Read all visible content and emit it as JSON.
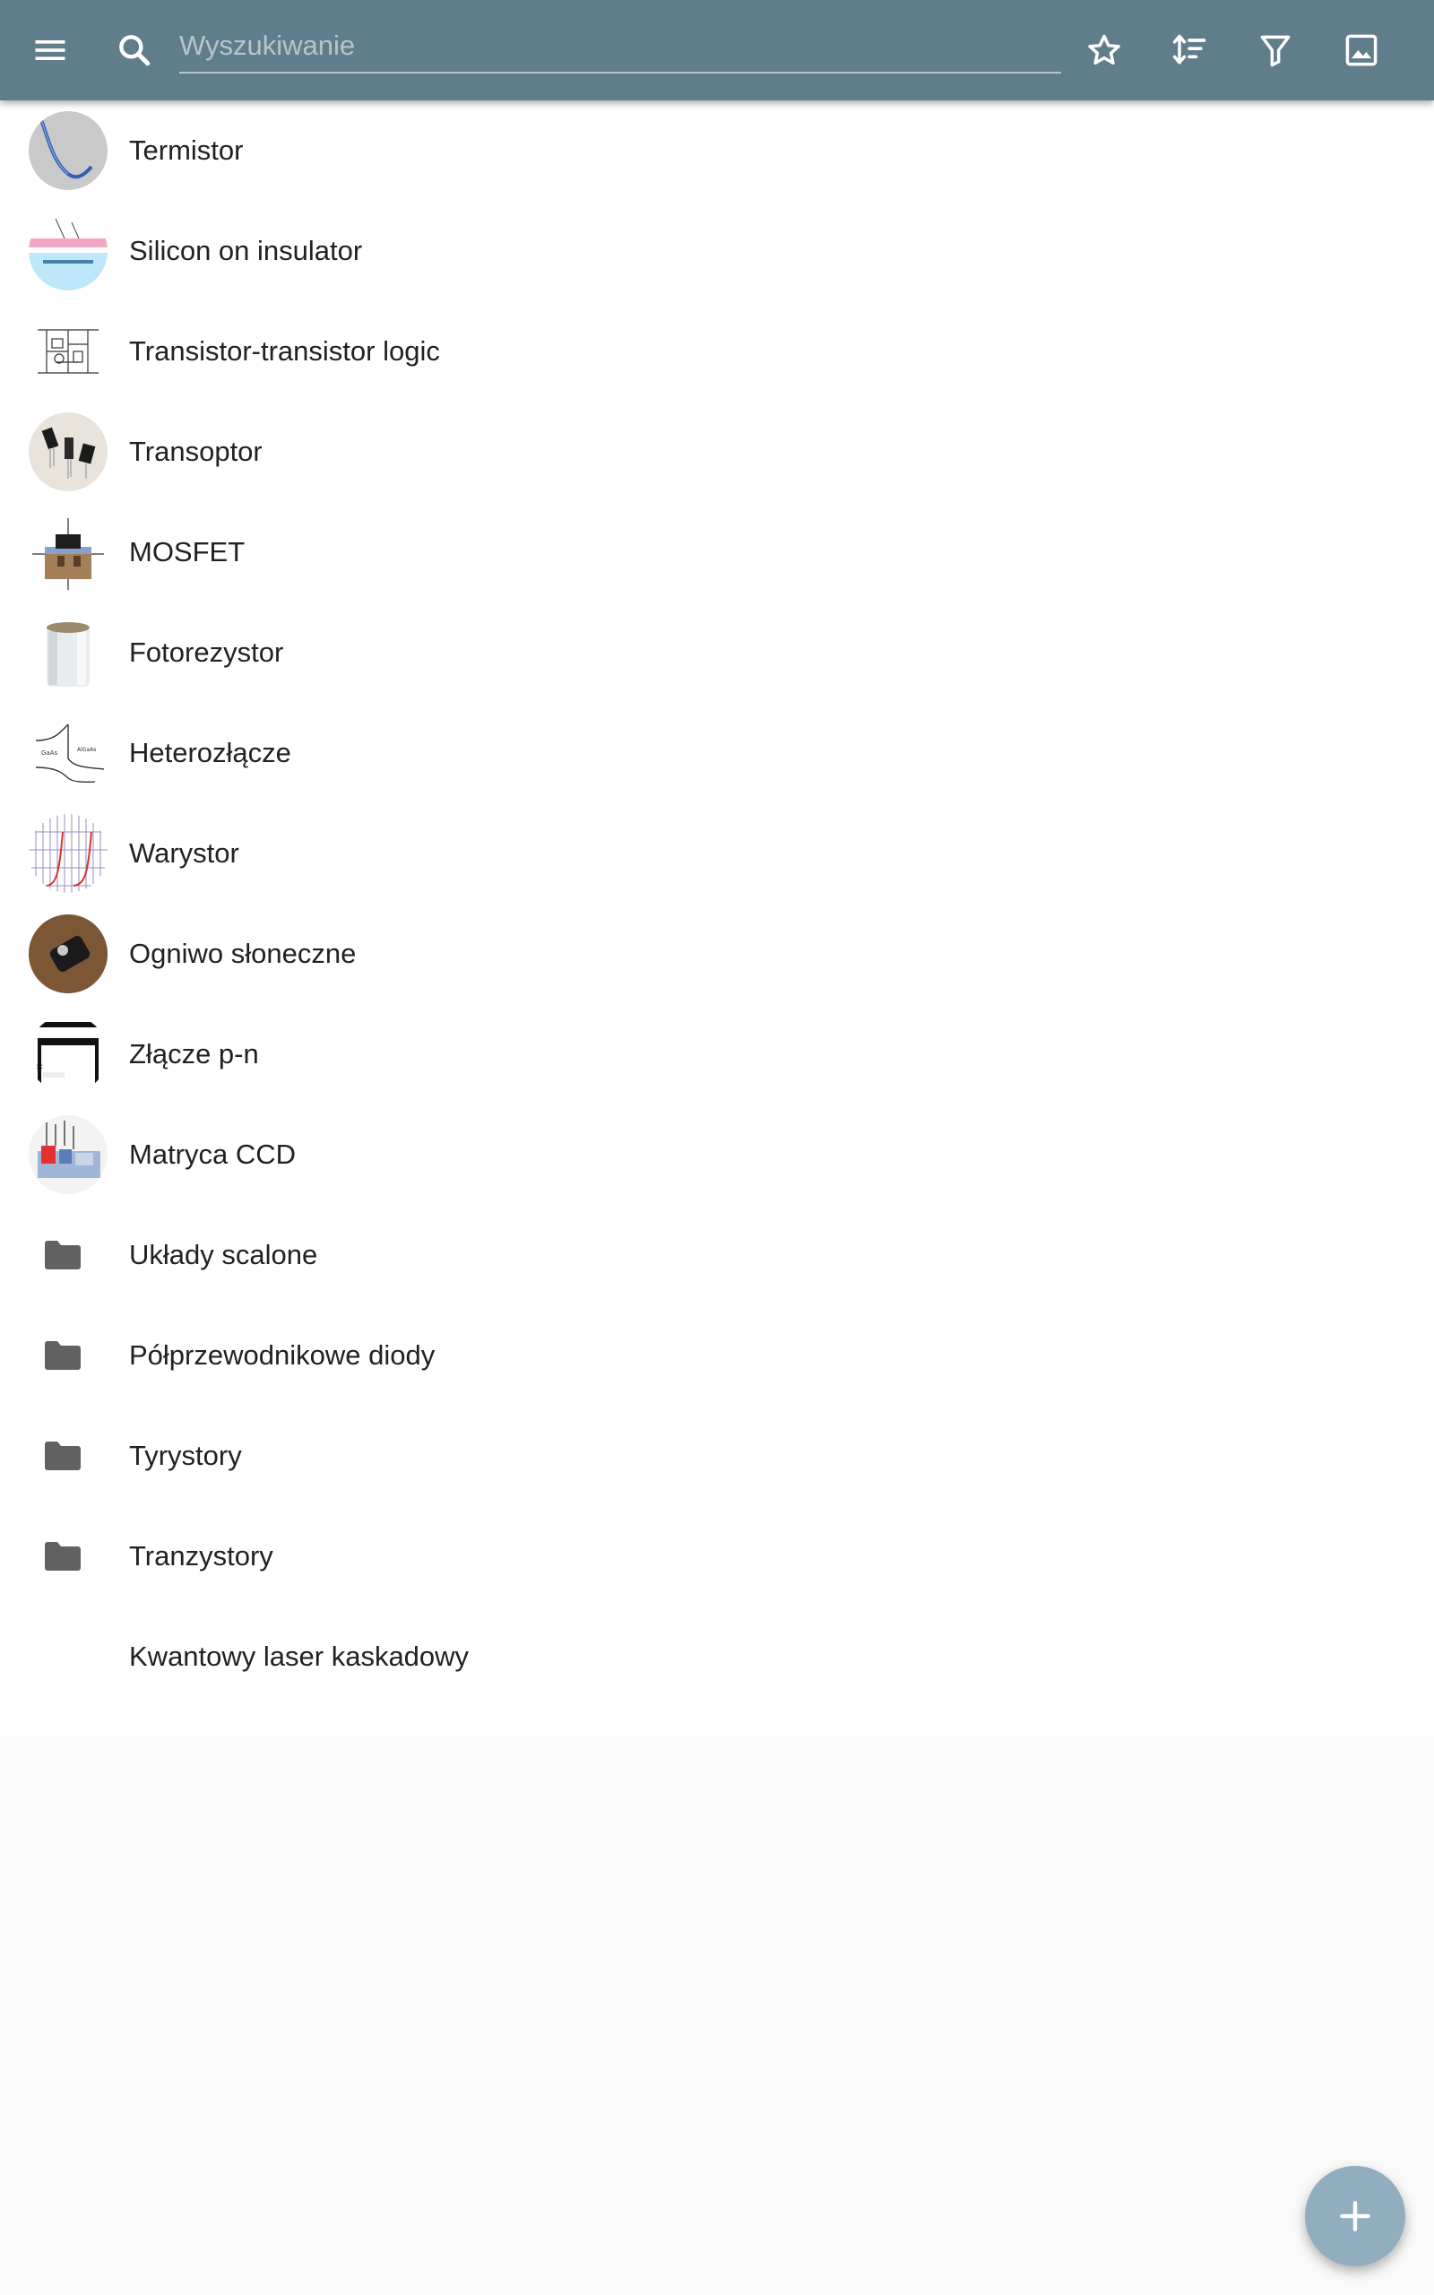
{
  "toolbar": {
    "menu_icon": "menu-icon",
    "search_icon": "search-icon",
    "search_placeholder": "Wyszukiwanie",
    "search_value": "",
    "actions": [
      "star-outline-icon",
      "sort-icon",
      "filter-icon",
      "image-icon"
    ],
    "background": "#607d8b"
  },
  "items": [
    {
      "label": "Termistor",
      "kind": "article"
    },
    {
      "label": "Silicon on insulator",
      "kind": "article"
    },
    {
      "label": "Transistor-transistor logic",
      "kind": "article"
    },
    {
      "label": "Transoptor",
      "kind": "article"
    },
    {
      "label": "MOSFET",
      "kind": "article"
    },
    {
      "label": "Fotorezystor",
      "kind": "article"
    },
    {
      "label": "Heterozłącze",
      "kind": "article"
    },
    {
      "label": "Warystor",
      "kind": "article"
    },
    {
      "label": "Ogniwo słoneczne",
      "kind": "article"
    },
    {
      "label": "Złącze p-n",
      "kind": "article"
    },
    {
      "label": "Matryca CCD",
      "kind": "article"
    },
    {
      "label": "Układy scalone",
      "kind": "folder"
    },
    {
      "label": "Półprzewodnikowe diody",
      "kind": "folder"
    },
    {
      "label": "Tyrystory",
      "kind": "folder"
    },
    {
      "label": "Tranzystory",
      "kind": "folder"
    },
    {
      "label": "Kwantowy laser kaskadowy",
      "kind": "article-no-image"
    }
  ],
  "fab": {
    "icon": "plus-icon",
    "color": "#90aec0"
  }
}
